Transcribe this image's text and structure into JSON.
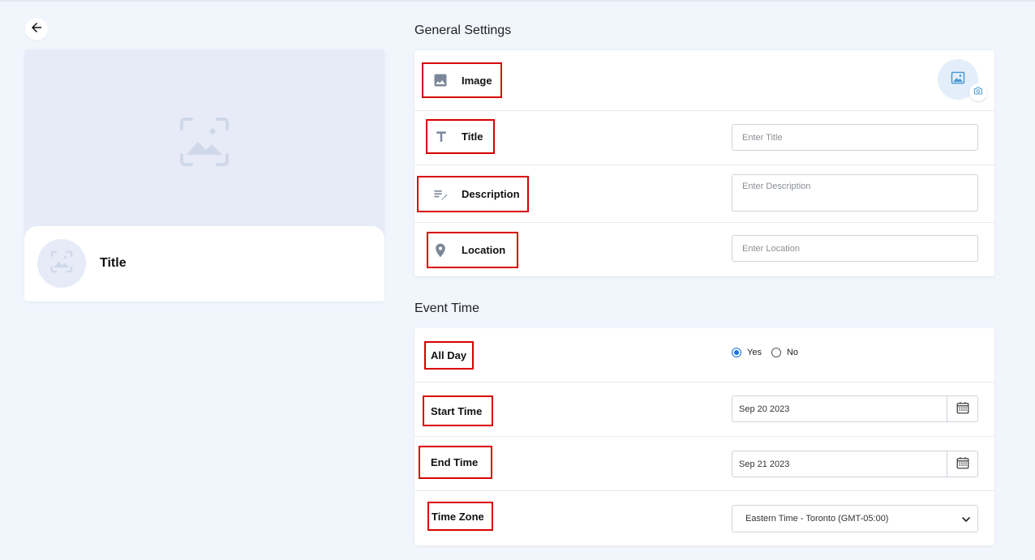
{
  "preview": {
    "title": "Title"
  },
  "general_settings": {
    "heading": "General Settings",
    "image": {
      "label": "Image"
    },
    "title": {
      "label": "Title",
      "placeholder": "Enter Title"
    },
    "description": {
      "label": "Description",
      "placeholder": "Enter Description"
    },
    "location": {
      "label": "Location",
      "placeholder": "Enter Location"
    }
  },
  "event_time": {
    "heading": "Event Time",
    "all_day": {
      "label": "All Day",
      "options": [
        "Yes",
        "No"
      ],
      "selected": "Yes"
    },
    "start_time": {
      "label": "Start Time",
      "value": "Sep 20 2023"
    },
    "end_time": {
      "label": "End Time",
      "value": "Sep 21 2023"
    },
    "time_zone": {
      "label": "Time Zone",
      "value": "Eastern Time - Toronto (GMT-05:00)"
    }
  },
  "colors": {
    "background": "#f1f5fc",
    "highlight_border": "#d90000",
    "accent": "#1a73e8",
    "icon_gray": "#7b8799"
  },
  "icons": [
    "arrow-left-icon",
    "image-placeholder-icon",
    "image-icon",
    "text-title-icon",
    "edit-note-icon",
    "location-pin-icon",
    "camera-icon",
    "calendar-icon",
    "chevron-down-icon"
  ]
}
